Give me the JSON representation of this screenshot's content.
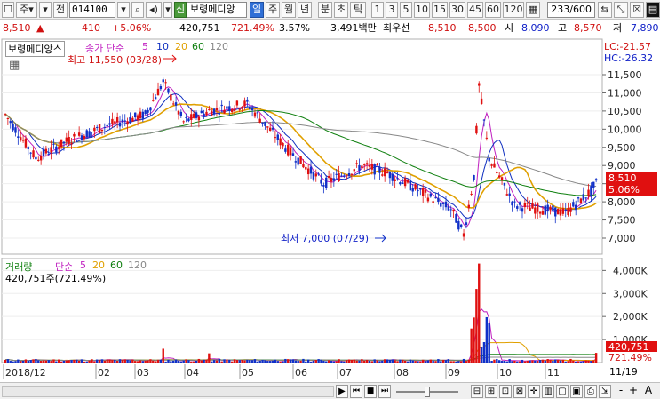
{
  "toolbar": {
    "market_label": "주",
    "period_label": "전",
    "code": "014100",
    "credit_badge": "신",
    "stock_name": "보령메디앙",
    "period_tabs": [
      "일",
      "주",
      "월",
      "년",
      "분",
      "초",
      "틱"
    ],
    "minute_buttons": [
      "1",
      "3",
      "5",
      "10",
      "15",
      "30",
      "45",
      "60",
      "120"
    ],
    "count": "233",
    "count_max": "/600"
  },
  "quote": {
    "price": "8,510",
    "direction": "▲",
    "change": "410",
    "change_rate": "+5.06%",
    "volume": "420,751",
    "volume_rate": "721.49%",
    "turnover": "3.57%",
    "amount": "3,491백만",
    "best_label": "최우선",
    "ask": "8,510",
    "bid": "8,500",
    "open_label": "시",
    "open": "8,090",
    "high_label": "고",
    "high": "8,570",
    "low_label": "저",
    "low": "7,890"
  },
  "price_panel": {
    "stock_label": "보령메디앙스",
    "ma_label": "종가 단순",
    "ma_periods": [
      "5",
      "10",
      "20",
      "60",
      "120"
    ],
    "ma_colors": [
      "#c020c0",
      "#1030c0",
      "#e0a000",
      "#108010",
      "#888888"
    ],
    "high_annotation": "최고 11,550 (03/28)",
    "low_annotation": "최저 7,000 (07/29)",
    "lc_label": "LC:-21.57",
    "hc_label": "HC:-26.32",
    "current_price_tag": "8,510",
    "current_rate_tag": "5.06%",
    "y_ticks": [
      "11,500",
      "11,000",
      "10,500",
      "10,000",
      "9,500",
      "9,000",
      "8,500",
      "8,000",
      "7,500",
      "7,000"
    ]
  },
  "volume_panel": {
    "label": "거래량",
    "ma_label": "단순",
    "ma_periods": [
      "5",
      "20",
      "60",
      "120"
    ],
    "summary": "420,751주(721.49%)",
    "y_ticks": [
      "4,000K",
      "3,000K",
      "2,000K",
      "1,000K"
    ],
    "current_tag": "420,751",
    "current_rate_tag": "721.49%"
  },
  "x_axis": {
    "labels": [
      "2018/12",
      "02",
      "03",
      "04",
      "05",
      "06",
      "07",
      "08",
      "09",
      "10",
      "11"
    ],
    "right_label": "11/19"
  },
  "colors": {
    "up": "#e01010",
    "down": "#1030c8",
    "ma5": "#c020c0",
    "ma10": "#1030c0",
    "ma20": "#e0a000",
    "ma60": "#108010",
    "ma120": "#888888",
    "tag_bg": "#e01010"
  }
}
